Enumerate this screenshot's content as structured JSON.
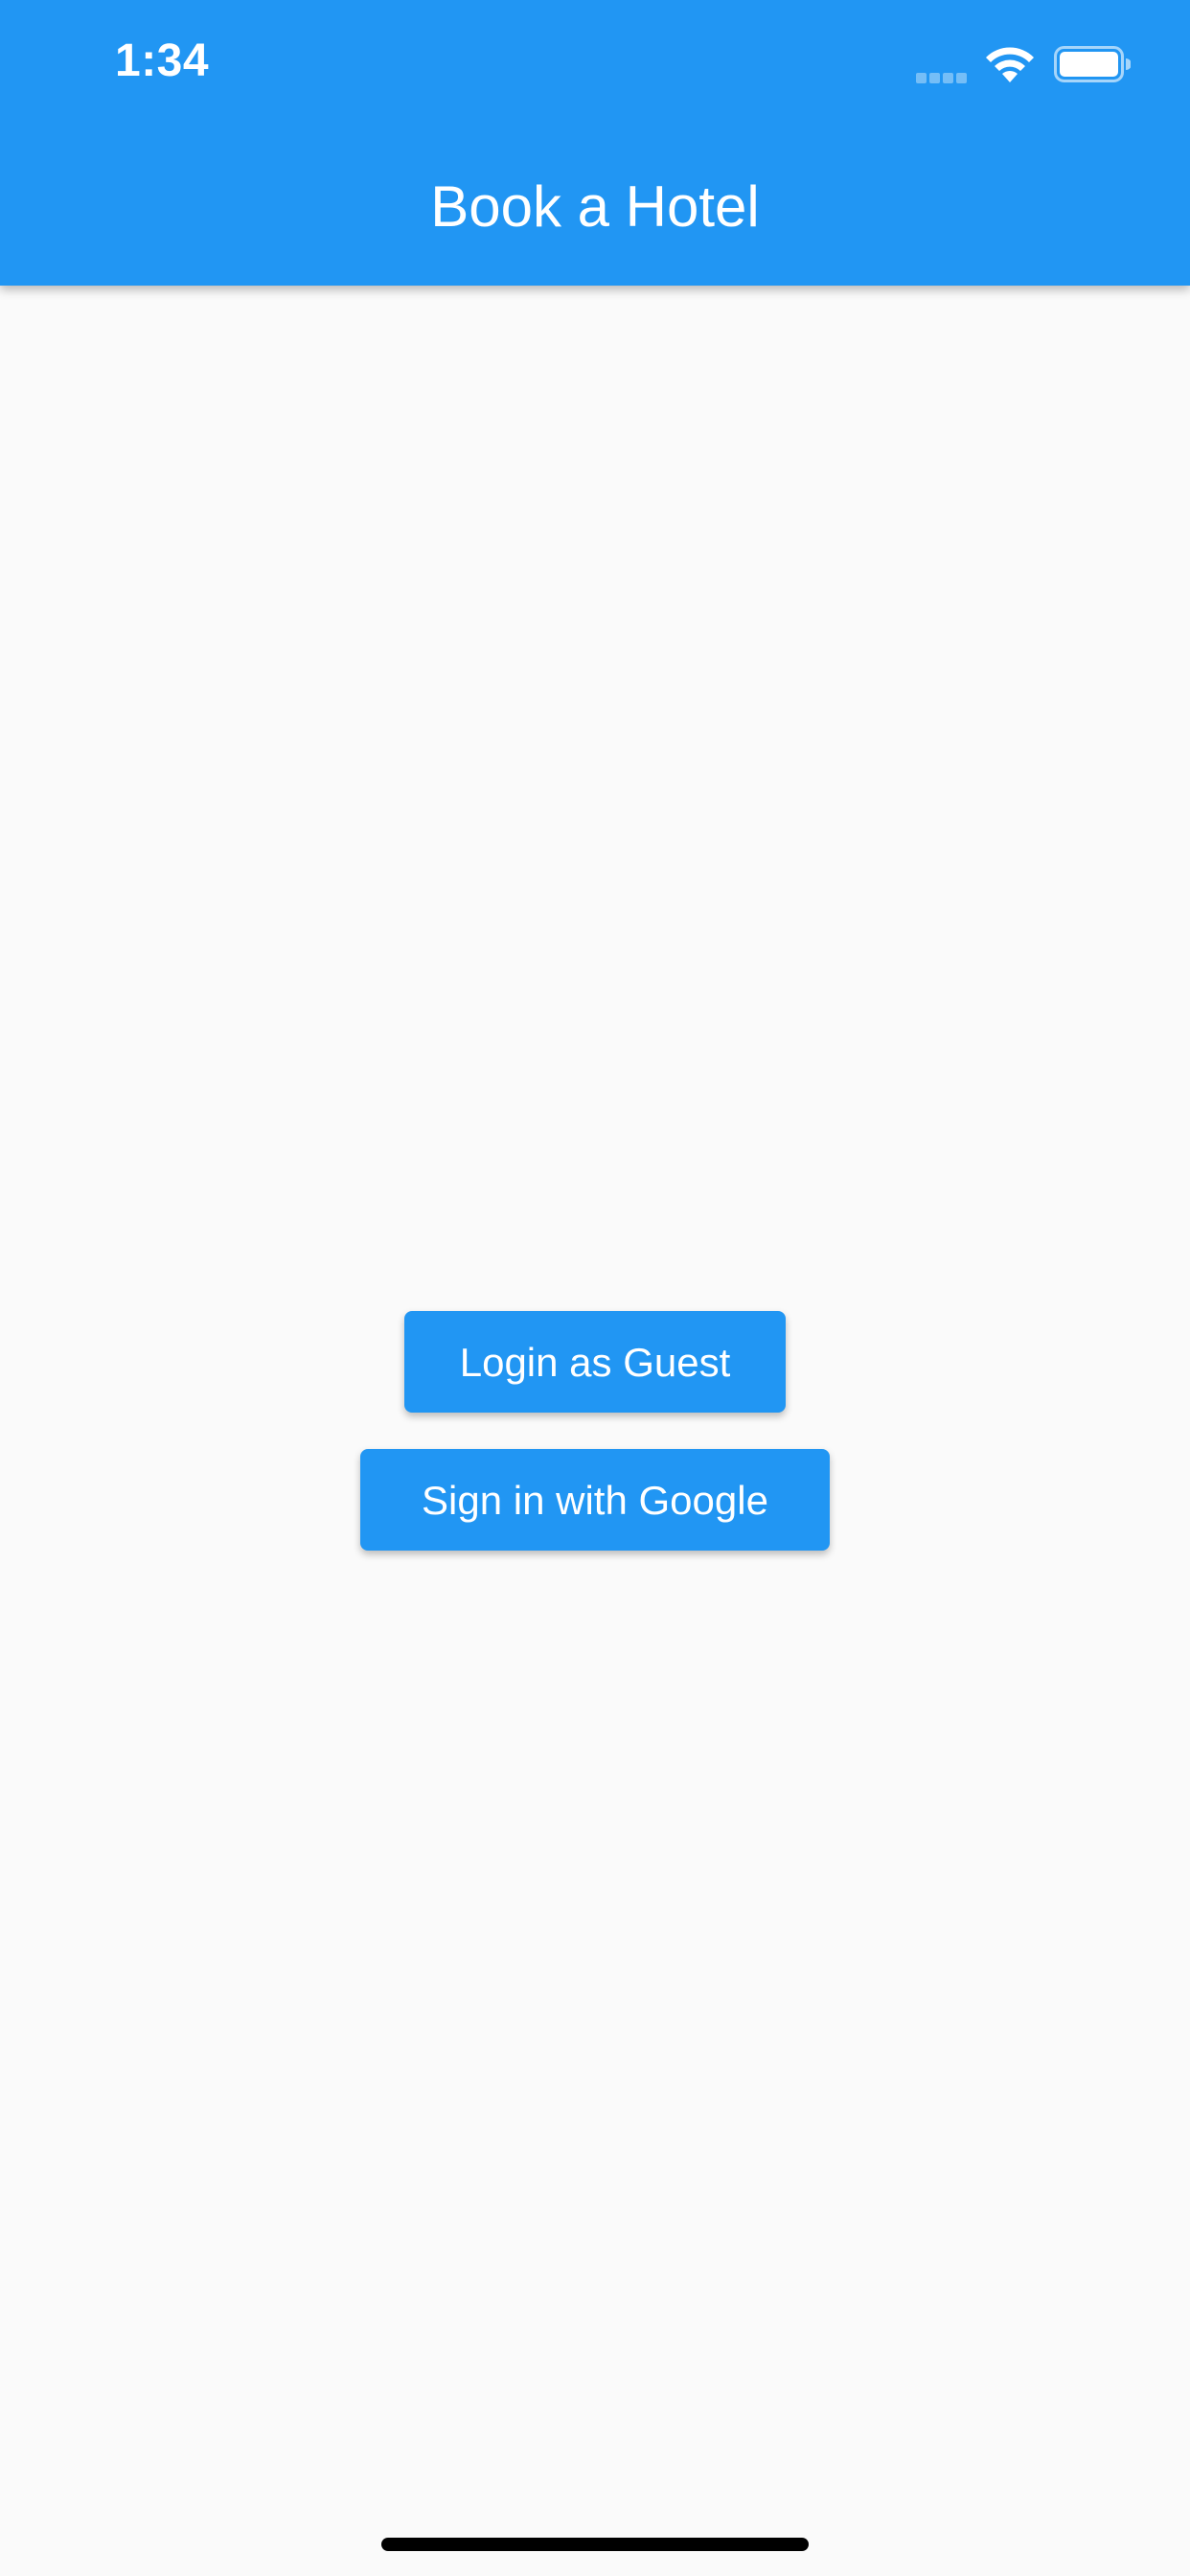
{
  "status_bar": {
    "time": "1:34",
    "icons": [
      "signal-icon",
      "wifi-icon",
      "battery-icon"
    ]
  },
  "app_bar": {
    "title": "Book a Hotel",
    "background_color": "#2196f3"
  },
  "main": {
    "guest_button_label": "Login as Guest",
    "google_button_label": "Sign in with Google",
    "button_color": "#2196f3",
    "background_color": "#fafafa"
  }
}
